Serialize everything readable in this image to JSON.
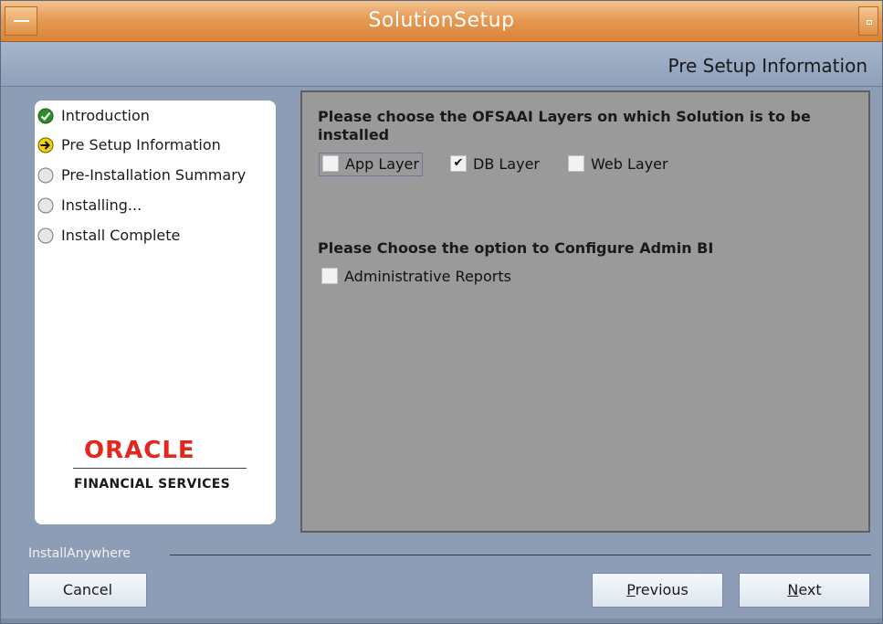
{
  "window": {
    "title": "SolutionSetup"
  },
  "header": {
    "step_title": "Pre Setup Information"
  },
  "steps": [
    {
      "label": "Introduction",
      "status": "done",
      "icon": "check-icon"
    },
    {
      "label": "Pre Setup Information",
      "status": "current",
      "icon": "arrow-icon"
    },
    {
      "label": "Pre-Installation Summary",
      "status": "pending",
      "icon": "circle-icon"
    },
    {
      "label": "Installing...",
      "status": "pending",
      "icon": "circle-icon"
    },
    {
      "label": "Install Complete",
      "status": "pending",
      "icon": "circle-icon"
    }
  ],
  "logo": {
    "brand": "ORACLE",
    "subtitle": "FINANCIAL SERVICES"
  },
  "layers": {
    "question": "Please choose the OFSAAI Layers on which Solution is to be installed",
    "options": [
      {
        "label": "App Layer",
        "checked": false
      },
      {
        "label": "DB Layer",
        "checked": true
      },
      {
        "label": "Web Layer",
        "checked": false
      }
    ]
  },
  "admin_bi": {
    "question": "Please Choose the option to Configure Admin BI",
    "options": [
      {
        "label": "Administrative Reports",
        "checked": false
      }
    ]
  },
  "footer": {
    "installer_label": "InstallAnywhere",
    "cancel_label": "Cancel",
    "previous_label": "Previous",
    "next_label": "Next"
  },
  "colors": {
    "titlebar": "#e79a55",
    "background": "#8d9db5",
    "content_panel": "#9a9a9a",
    "oracle_red": "#e3261e"
  }
}
